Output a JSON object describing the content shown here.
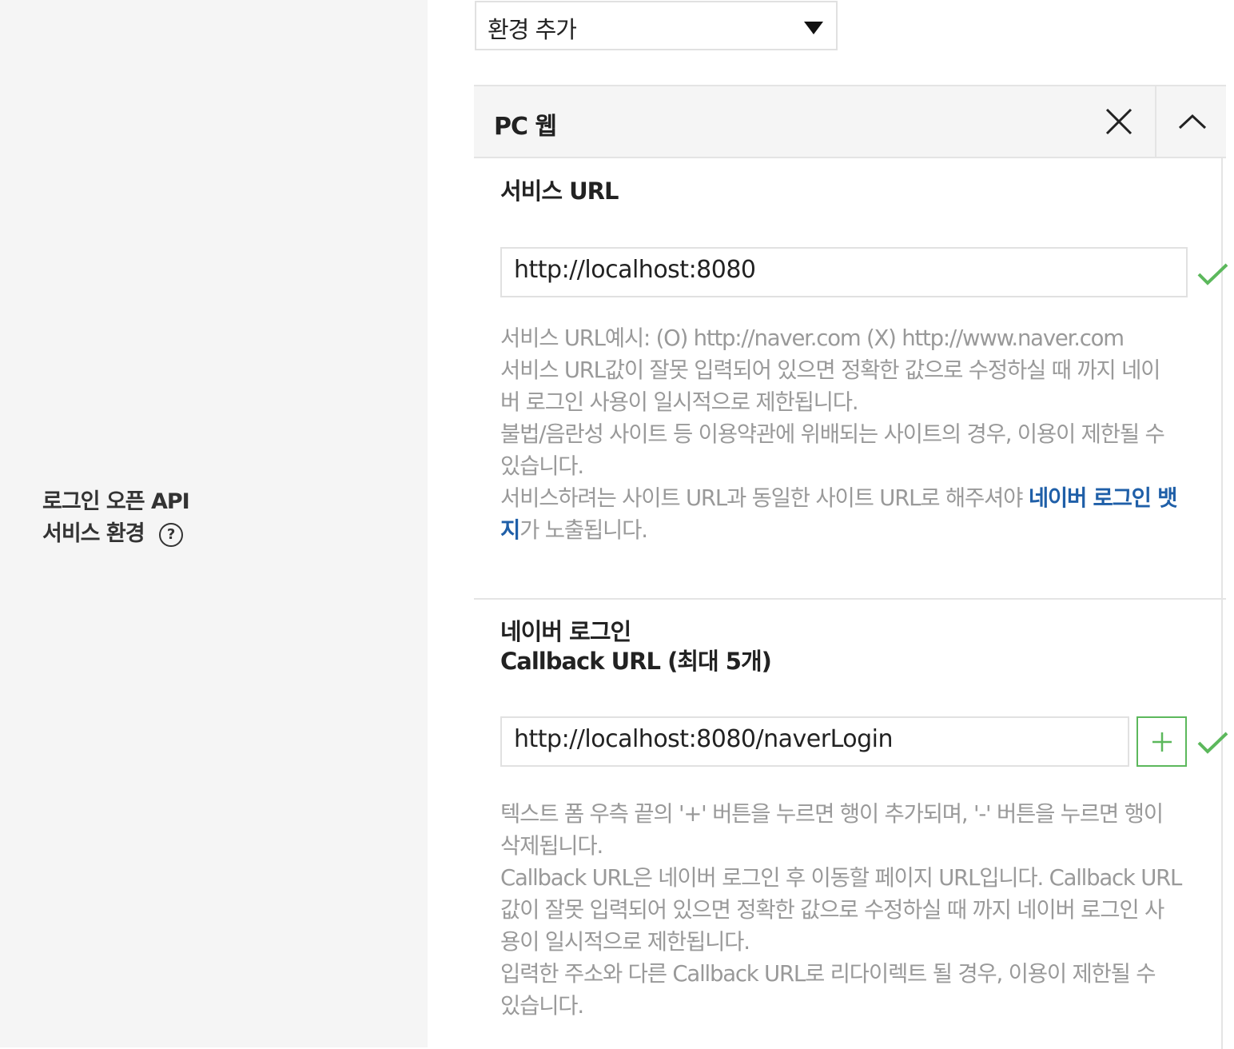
{
  "left_label": {
    "line1": "로그인 오픈 API",
    "line2": "서비스 환경",
    "help": "?"
  },
  "env_select": {
    "value": "환경 추가"
  },
  "panel": {
    "title": "PC 웹",
    "service_url": {
      "label": "서비스 URL",
      "value": "http://localhost:8080",
      "help_lines": [
        "서비스 URL예시: (O) http://naver.com (X) http://www.naver.com",
        "서비스 URL값이 잘못 입력되어 있으면 정확한 값으로 수정하실 때 까지 네이",
        "버 로그인 사용이 일시적으로 제한됩니다.",
        "불법/음란성 사이트 등 이용약관에 위배되는 사이트의 경우, 이용이 제한될 수",
        "있습니다."
      ],
      "help_line6_pre": "서비스하려는 사이트 URL과 동일한 사이트 URL로 해주셔야 ",
      "help_line6_link": "네이버 로그인 뱃",
      "help_line7_link": "지",
      "help_line7_post": "가 노출됩니다."
    },
    "callback": {
      "label_line1": "네이버 로그인",
      "label_line2": "Callback URL (최대 5개)",
      "value": "http://localhost:8080/naverLogin",
      "help_lines": [
        "텍스트 폼 우측 끝의 '+' 버튼을 누르면 행이 추가되며, '-' 버튼을 누르면 행이",
        "삭제됩니다.",
        "Callback URL은 네이버 로그인 후 이동할 페이지 URL입니다. Callback URL",
        "값이 잘못 입력되어 있으면 정확한 값으로 수정하실 때 까지 네이버 로그인 사",
        "용이 일시적으로 제한됩니다.",
        "입력한 주소와 다른 Callback URL로 리다이렉트 될 경우, 이용이 제한될 수",
        "있습니다."
      ]
    }
  },
  "icons": {
    "help": "question-circle-icon",
    "dropdown": "triangle-down-icon",
    "close": "close-x-icon",
    "collapse": "chevron-up-icon",
    "check": "check-icon",
    "add": "plus-icon"
  },
  "colors": {
    "left_bg": "#f5f5f5",
    "header_bg": "#f5f5f5",
    "border": "#e4e4e4",
    "help_text": "#999999",
    "link": "#1f5fa8",
    "check": "#5cb85c"
  }
}
